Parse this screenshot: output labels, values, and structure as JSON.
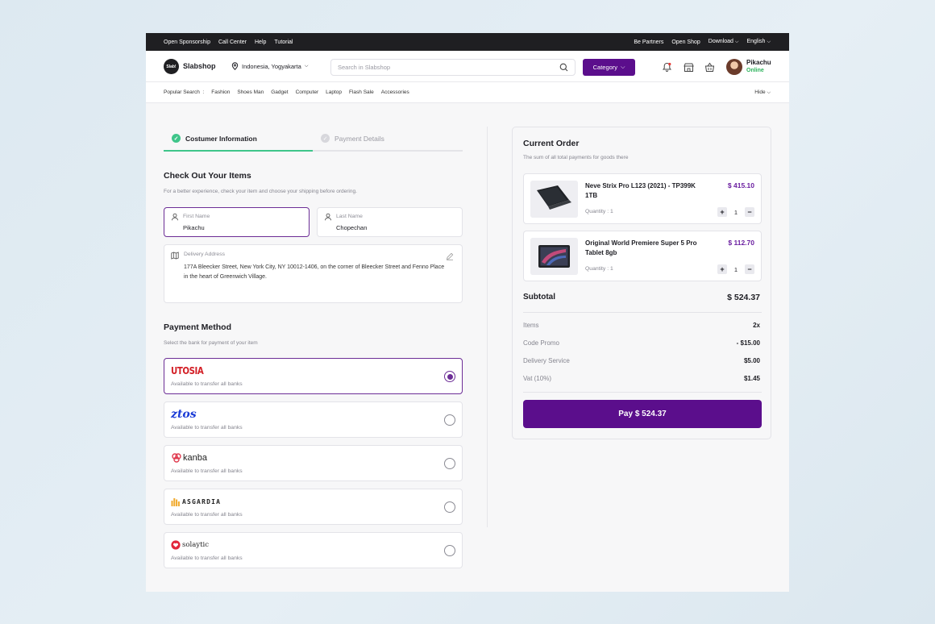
{
  "topbar": {
    "left_links": [
      "Open Sponsorship",
      "Call Center",
      "Help",
      "Tutorial"
    ],
    "right_links": [
      "Be Partners",
      "Open Shop"
    ],
    "download": "Download",
    "language": "English"
  },
  "header": {
    "logo_mark": "Slab!",
    "brand": "Slabshop",
    "location": "Indonesia, Yogyakarta",
    "search_placeholder": "Search in Slabshop",
    "category_button": "Category",
    "user_name": "Pikachu",
    "user_status": "Online"
  },
  "popular": {
    "label": "Popular Search",
    "items": [
      "Fashion",
      "Shoes Man",
      "Gadget",
      "Computer",
      "Laptop",
      "Flash Sale",
      "Accessories"
    ],
    "hide": "Hide"
  },
  "steps": {
    "step1": "Costumer Information",
    "step2": "Payment Details"
  },
  "checkout": {
    "title": "Check Out Your Items",
    "subtitle": "For a better experience, check your item and choose your shipping before ordering.",
    "first_name_label": "First Name",
    "first_name_value": "Pikachu",
    "last_name_label": "Last Name",
    "last_name_value": "Chopechan",
    "address_label": "Delivery Address",
    "address_value": "177A Bleecker Street, New York City, NY 10012-1406, on the corner of Bleecker Street and Fenno Place in the heart of Greenwich Village."
  },
  "payment": {
    "title": "Payment Method",
    "subtitle": "Select the bank for payment of your item",
    "banks": [
      {
        "name": "UTOSIA",
        "sub": "Available to transfer all banks",
        "selected": true
      },
      {
        "name": "ztos",
        "sub": "Available to transfer all banks",
        "selected": false
      },
      {
        "name": "kanba",
        "sub": "Available to transfer all banks",
        "selected": false
      },
      {
        "name": "ASGARDIA",
        "sub": "Available to transfer all banks",
        "selected": false
      },
      {
        "name": "solaytic",
        "sub": "Available to transfer all banks",
        "selected": false
      }
    ]
  },
  "order": {
    "title": "Current Order",
    "subtitle": "The sum of all total payments for goods there",
    "items": [
      {
        "name": "Neve Strix Pro L123 (2021) - TP399K 1TB",
        "price": "$ 415.10",
        "qty_label": "Quantity : 1",
        "qty": "1"
      },
      {
        "name": "Original World Premiere Super 5 Pro Tablet 8gb",
        "price": "$ 112.70",
        "qty_label": "Quantity : 1",
        "qty": "1"
      }
    ],
    "subtotal_label": "Subtotal",
    "subtotal_value": "$ 524.37",
    "rows": [
      {
        "label": "Items",
        "value": "2x"
      },
      {
        "label": "Code Promo",
        "value": "- $15.00"
      },
      {
        "label": "Delivery Service",
        "value": "$5.00"
      },
      {
        "label": "Vat (10%)",
        "value": "$1.45"
      }
    ],
    "pay_button": "Pay $ 524.37"
  },
  "colors": {
    "accent": "#5b0e8c",
    "price": "#6b1fa0",
    "success": "#3fc58a",
    "topbar": "#1f1f22"
  }
}
